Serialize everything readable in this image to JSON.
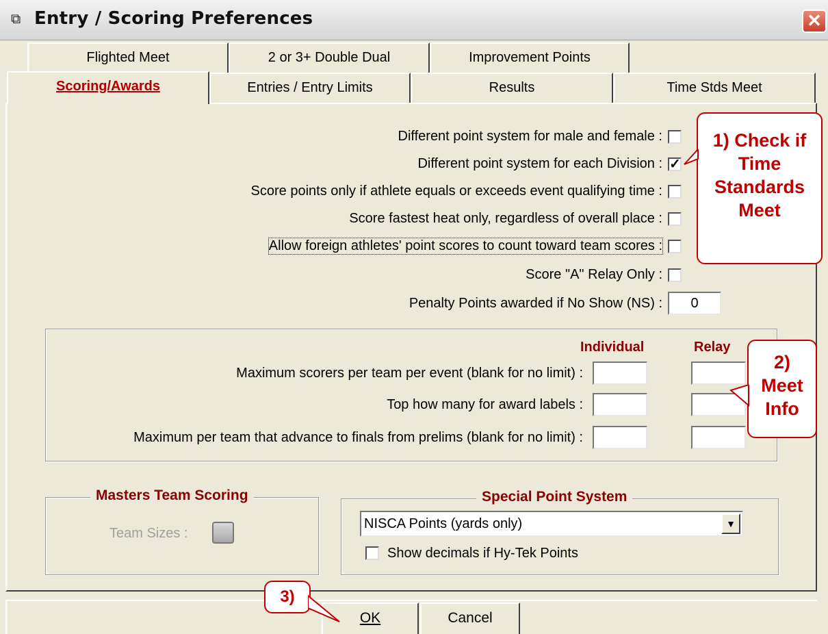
{
  "window": {
    "title": "Entry / Scoring Preferences"
  },
  "tabs_row1": [
    {
      "label": "Flighted Meet"
    },
    {
      "label": "2 or 3+ Double Dual"
    },
    {
      "label": "Improvement Points"
    }
  ],
  "tabs_row2": [
    {
      "label": "Scoring/Awards",
      "active": true
    },
    {
      "label": "Entries / Entry Limits"
    },
    {
      "label": "Results"
    },
    {
      "label": "Time Stds Meet"
    }
  ],
  "options": [
    {
      "label": "Different point system for male and female :",
      "checked": false
    },
    {
      "label": "Different point system for each Division :",
      "checked": true
    },
    {
      "label": "Score points only if athlete equals or exceeds event qualifying time :",
      "checked": false
    },
    {
      "label": "Score fastest heat only, regardless of overall place :",
      "checked": false
    },
    {
      "label": "Allow foreign athletes' point scores to count toward team scores :",
      "checked": false
    },
    {
      "label": "Score \"A\" Relay Only :",
      "checked": false
    }
  ],
  "penalty": {
    "label": "Penalty Points awarded if No Show (NS) :",
    "value": "0"
  },
  "limits": {
    "col_individual": "Individual",
    "col_relay": "Relay",
    "rows": [
      {
        "label": "Maximum scorers per team per event (blank for no limit) :",
        "individual": "",
        "relay": ""
      },
      {
        "label": "Top how many for award labels :",
        "individual": "",
        "relay": ""
      },
      {
        "label": "Maximum per team that advance to finals from prelims (blank for no limit) :",
        "individual": "",
        "relay": ""
      }
    ]
  },
  "masters": {
    "legend": "Masters Team Scoring",
    "team_sizes_label": "Team Sizes :"
  },
  "special": {
    "legend": "Special Point System",
    "selected": "NISCA Points (yards only)",
    "decimals_label": "Show decimals if Hy-Tek Points",
    "decimals_checked": false
  },
  "buttons": {
    "ok": "OK",
    "cancel": "Cancel"
  },
  "callouts": {
    "c1": [
      "1) Check if",
      "Time",
      "Standards",
      "Meet"
    ],
    "c2": [
      "2)",
      "Meet",
      "Info"
    ],
    "c3": "3)"
  },
  "colors": {
    "accent_red": "#c00000",
    "legend_red": "#8b0000"
  }
}
